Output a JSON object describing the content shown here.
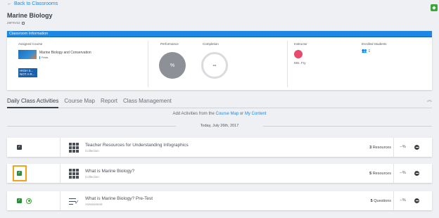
{
  "nav": {
    "back_label": "Back to Classrooms"
  },
  "classroom": {
    "name": "Marine Biology",
    "code": "Z8F9V53"
  },
  "info": {
    "header": "Classroom Information",
    "assigned_course_label": "Assigned Course",
    "course_name": "Marine Biology and Conservation",
    "course_tag": "Frisks",
    "hs_thumb_text": "HIGH S... NOT A R...",
    "performance_label": "Performance",
    "performance_value": "%",
    "completion_label": "Completion",
    "completion_value": "--",
    "instructor_label": "Instructor",
    "instructor_name": "Mrs. Fry",
    "enrolled_label": "Enrolled Students",
    "enrolled_count": "1"
  },
  "tabs": [
    {
      "label": "Daily Class Activities",
      "active": true
    },
    {
      "label": "Course Map",
      "active": false
    },
    {
      "label": "Report",
      "active": false
    },
    {
      "label": "Class Management",
      "active": false
    }
  ],
  "add_activities": {
    "prefix": "Add Activities from the",
    "course_map": "Course Map",
    "or": "or",
    "my_content": "My Content"
  },
  "date_label": "Today, July 26th, 2017",
  "activities": [
    {
      "title": "Teacher Resources for Understanding Infographics",
      "type": "Collection",
      "count": "3",
      "count_unit": "Resources",
      "percent": "--%",
      "icon": "grid-icon"
    },
    {
      "title": "What is Marine Biology?",
      "type": "Collection",
      "count": "5",
      "count_unit": "Resources",
      "percent": "--%",
      "icon": "grid-icon"
    },
    {
      "title": "What is Marine Biology? Pre-Test",
      "type": "Assessment",
      "count": "5",
      "count_unit": "Questions",
      "percent": "--%",
      "icon": "assessment-icon"
    }
  ],
  "colors": {
    "accent": "#1e88e5",
    "check_green": "#2e8b3e",
    "highlight": "#f3a21b"
  }
}
